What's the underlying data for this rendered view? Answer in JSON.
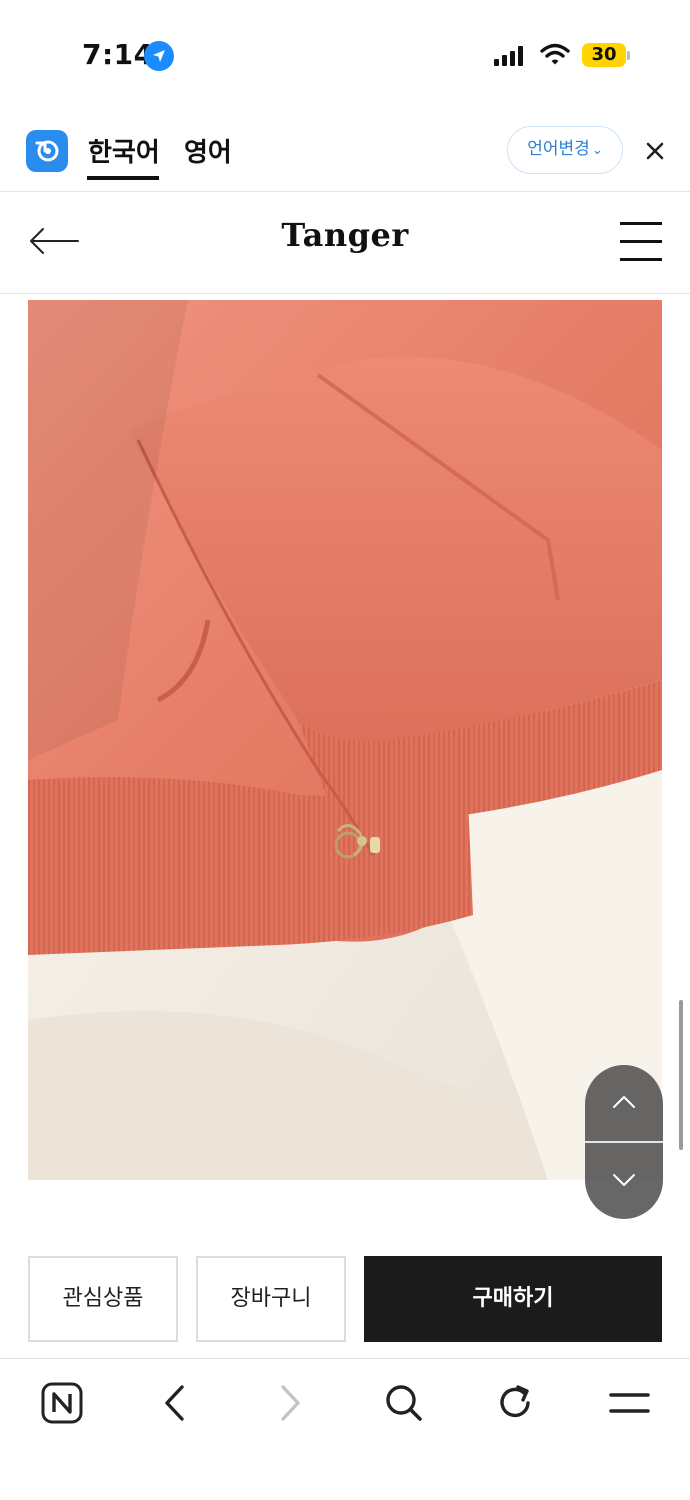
{
  "status_bar": {
    "time": "7:14",
    "battery": "30",
    "icons": [
      "location-arrow-icon",
      "cellular-signal-icon",
      "wifi-icon",
      "battery-icon"
    ]
  },
  "translate_bar": {
    "tabs": [
      {
        "label": "한국어",
        "active": true
      },
      {
        "label": "영어",
        "active": false
      }
    ],
    "language_change_label": "언어변경",
    "accent_color": "#2b8cf0"
  },
  "site_header": {
    "logo_text": "Tanger"
  },
  "product": {
    "image_subject": "coral velour hoodie with zip charm on white sheet",
    "colors": {
      "fabric": "#e8826f",
      "background": "#f3ede6"
    }
  },
  "actions": {
    "wishlist_label": "관심상품",
    "cart_label": "장바구니",
    "buy_label": "구매하기"
  },
  "browser_toolbar": {
    "icons": [
      "naver-n-icon",
      "back-icon",
      "forward-icon",
      "search-icon",
      "refresh-icon",
      "menu-icon"
    ]
  }
}
